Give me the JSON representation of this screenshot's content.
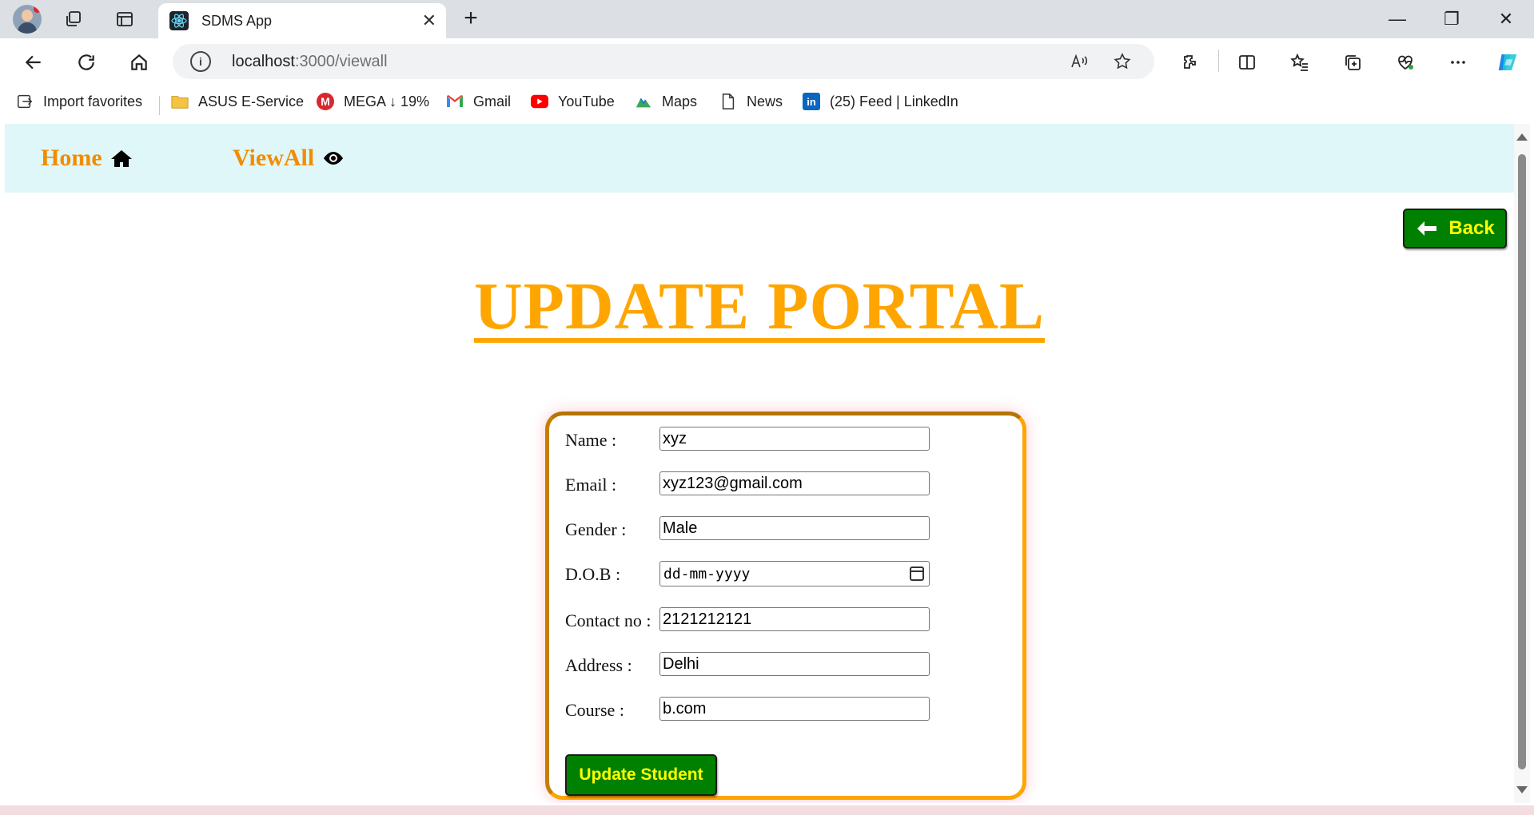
{
  "browser": {
    "tab_title": "SDMS App",
    "tab_close": "✕",
    "new_tab": "+",
    "window_controls": {
      "minimize": "—",
      "restore": "❐",
      "close": "✕"
    },
    "address": {
      "host": "localhost",
      "path": ":3000/viewall"
    },
    "bookmarks": [
      {
        "label": "Import favorites",
        "icon": "import-favorites-icon"
      },
      {
        "label": "ASUS E-Service",
        "icon": "folder-icon"
      },
      {
        "label": "MEGA ↓ 19%",
        "icon": "mega-icon"
      },
      {
        "label": "Gmail",
        "icon": "gmail-icon"
      },
      {
        "label": "YouTube",
        "icon": "youtube-icon"
      },
      {
        "label": "Maps",
        "icon": "maps-icon"
      },
      {
        "label": "News",
        "icon": "news-icon"
      },
      {
        "label": "(25) Feed | LinkedIn",
        "icon": "linkedin-icon"
      }
    ]
  },
  "navbar": {
    "home_label": "Home",
    "viewall_label": "ViewAll"
  },
  "back_label": "Back",
  "page_title": "UPDATE PORTAL",
  "form": {
    "name_label": "Name :",
    "name_value": "xyz",
    "email_label": "Email :",
    "email_value": "xyz123@gmail.com",
    "gender_label": "Gender :",
    "gender_value": "Male",
    "dob_label": "D.O.B :",
    "dob_placeholder": "dd-mm-yyyy",
    "contact_label": "Contact no :",
    "contact_value": "2121212121",
    "address_label": "Address :",
    "address_value": "Delhi",
    "course_label": "Course :",
    "course_value": "b.com",
    "submit_label": "Update Student"
  },
  "colors": {
    "accent_orange": "#ffa500",
    "nav_orange": "#f28c00",
    "button_green": "#008000",
    "button_text": "#ffff00",
    "navbar_bg": "#dff7f8"
  }
}
